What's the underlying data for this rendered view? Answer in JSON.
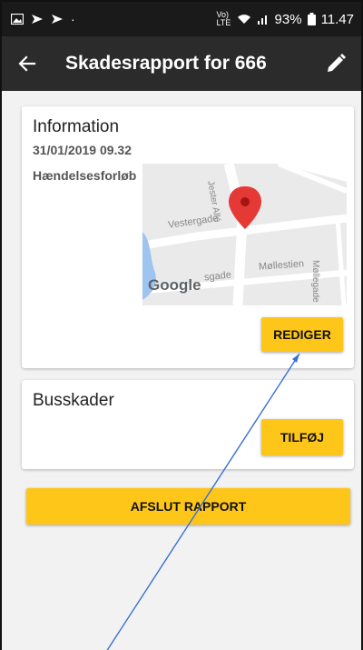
{
  "status_bar": {
    "left_icons": [
      "gallery-icon",
      "cast-icon",
      "cast-icon",
      "dot-icon"
    ],
    "network": "Vo) LTE",
    "battery": "93%",
    "time": "11.47"
  },
  "app_bar": {
    "title": "Skadesrapport for 666",
    "back_icon": "arrow-left-icon",
    "edit_icon": "pencil-icon"
  },
  "info_card": {
    "title": "Information",
    "datetime": "31/01/2019 09.32",
    "description_label": "Hændelsesforløb",
    "map": {
      "streets": [
        "Vestergade",
        "Møllestien",
        "Møllegade",
        "Jester Allé",
        "sgade"
      ],
      "logo": "Google"
    },
    "edit_button": "REDIGER"
  },
  "bus_card": {
    "title": "Busskader",
    "add_button": "TILFØJ"
  },
  "finish_button": "AFSLUT RAPPORT",
  "colors": {
    "status_bar": "#1a1a1a",
    "app_bar": "#2b2b2b",
    "accent_yellow": "#ffc61a",
    "background": "#f2f2f2",
    "pin_red": "#e53935",
    "annotation_line": "#3a6fd8"
  }
}
